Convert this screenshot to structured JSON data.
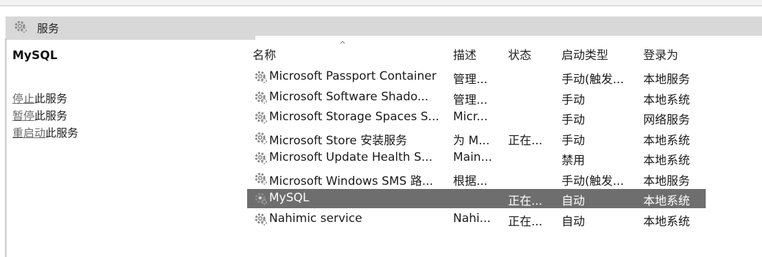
{
  "window": {
    "title": "服务"
  },
  "left_pane": {
    "service_name": "MySQL",
    "actions": [
      {
        "link": "停止",
        "suffix": "此服务"
      },
      {
        "link": "暂停",
        "suffix": "此服务"
      },
      {
        "link": "重启动",
        "suffix": "此服务"
      }
    ]
  },
  "table": {
    "columns": [
      "名称",
      "描述",
      "状态",
      "启动类型",
      "登录为"
    ],
    "sort_indicator": "^",
    "rows": [
      {
        "name": "Microsoft Passport Container",
        "desc": "管理...",
        "status": "",
        "startup": "手动(触发...",
        "logon": "本地服务"
      },
      {
        "name": "Microsoft Software Shado...",
        "desc": "管理...",
        "status": "",
        "startup": "手动",
        "logon": "本地系统"
      },
      {
        "name": "Microsoft Storage Spaces S...",
        "desc": "Micr...",
        "status": "",
        "startup": "手动",
        "logon": "网络服务"
      },
      {
        "name": "Microsoft Store 安装服务",
        "desc": "为 M...",
        "status": "正在...",
        "startup": "手动",
        "logon": "本地系统"
      },
      {
        "name": "Microsoft Update Health S...",
        "desc": "Main...",
        "status": "",
        "startup": "禁用",
        "logon": "本地系统"
      },
      {
        "name": "Microsoft Windows SMS 路...",
        "desc": "根据...",
        "status": "",
        "startup": "手动(触发...",
        "logon": "本地服务"
      },
      {
        "name": "MySQL",
        "desc": "",
        "status": "正在...",
        "startup": "自动",
        "logon": "本地系统"
      },
      {
        "name": "Nahimic service",
        "desc": "Nahi...",
        "status": "正在...",
        "startup": "自动",
        "logon": "本地系统"
      }
    ]
  },
  "icons": {
    "header": "services-gear-icon",
    "row": "service-gear-icon"
  },
  "colors": {
    "header_bar": "#d8d8d8",
    "selection": "#6e6e6e"
  }
}
